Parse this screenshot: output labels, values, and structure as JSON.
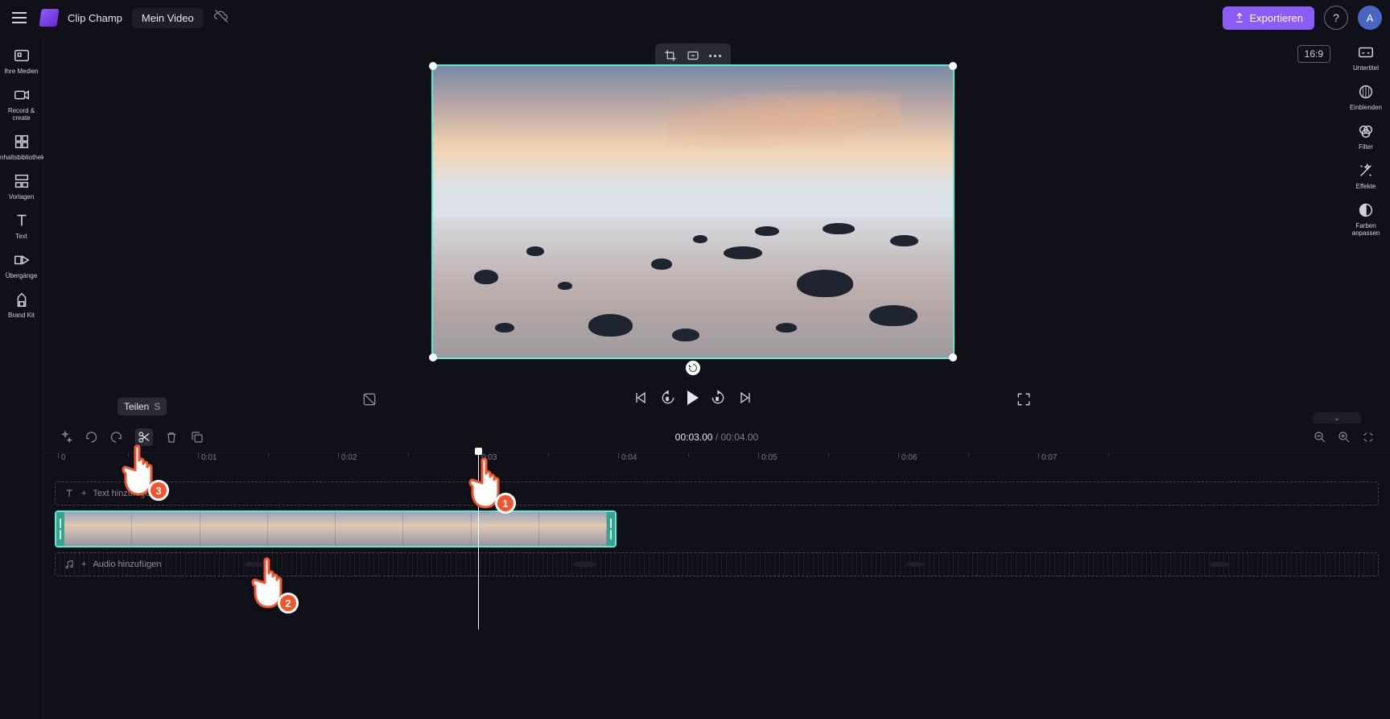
{
  "app": {
    "brand": "Clip Champ",
    "project": "Mein Video"
  },
  "export": {
    "label": "Exportieren"
  },
  "avatar": {
    "initial": "A"
  },
  "aspect": {
    "label": "16:9"
  },
  "left_sidebar": {
    "items": [
      {
        "label": "Ihre Medien"
      },
      {
        "label": "Record &amp; create"
      },
      {
        "label": "Inhaltsbibliothek"
      },
      {
        "label": "Vorlagen"
      },
      {
        "label": "Text"
      },
      {
        "label": "Übergänge"
      },
      {
        "label": "Brand Kit"
      }
    ]
  },
  "right_sidebar": {
    "items": [
      {
        "label": "Untertitel"
      },
      {
        "label": "Einblenden"
      },
      {
        "label": "Filter"
      },
      {
        "label": "Effekte"
      },
      {
        "label": "Farben anpassen"
      }
    ]
  },
  "tooltip": {
    "label": "Teilen",
    "key": "S"
  },
  "time": {
    "current": "00:03.00",
    "sep": " / ",
    "duration": "00:04.00"
  },
  "ruler": {
    "ticks": [
      "0",
      "0:01",
      "0:02",
      "0:03",
      "0:04",
      "0:05",
      "0:06",
      "0:07"
    ]
  },
  "tracks": {
    "text_placeholder": "Text hinzufügen",
    "audio_placeholder": "Audio hinzufügen"
  },
  "annotations": {
    "b1": "1",
    "b2": "2",
    "b3": "3"
  }
}
